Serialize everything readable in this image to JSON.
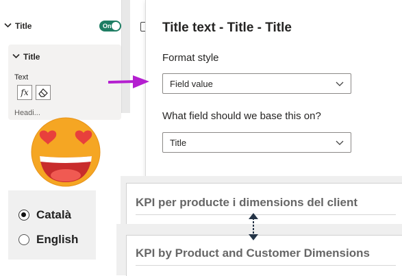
{
  "format_pane": {
    "section_title": "Title",
    "toggle_label": "On",
    "card_title": "Title",
    "text_label": "Text",
    "fx_label": "fx",
    "next_label_cut": "Headi..."
  },
  "dialog": {
    "title": "Title text - Title - Title",
    "format_style_label": "Format style",
    "format_style_value": "Field value",
    "field_label": "What field should we base this on?",
    "field_value": "Title"
  },
  "languages": {
    "options": [
      "Català",
      "English"
    ],
    "selected": "Català"
  },
  "visuals": {
    "catalan_title": "KPI per producte i dimensions del client",
    "english_title": "KPI by Product and Customer Dimensions"
  },
  "colors": {
    "toggle": "#1e7d63",
    "arrow": "#b41fd0",
    "emoji_face": "#f5a623",
    "heart": "#e8403c"
  }
}
